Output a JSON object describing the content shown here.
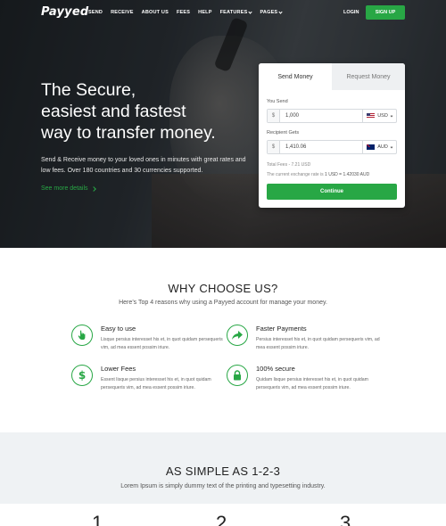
{
  "brand": {
    "logo": "Payyed",
    "accent": "#28a745"
  },
  "nav": {
    "items": [
      "SEND",
      "RECEIVE",
      "ABOUT US",
      "FEES",
      "HELP"
    ],
    "features_label": "FEATURES",
    "pages_label": "PAGES",
    "login_label": "LOGIN",
    "signup_label": "SIGN UP"
  },
  "hero": {
    "title_line1": "The Secure,",
    "title_line2": "easiest and fastest",
    "title_line3": "way to transfer money.",
    "text": "Send & Receive money to your loved ones in minutes with great rates and low fees. Over 180 countries and 30 currencies supported.",
    "see_more": "See more details"
  },
  "form": {
    "tab_send": "Send Money",
    "tab_request": "Request Money",
    "you_send_label": "You Send",
    "you_send_symbol": "$",
    "you_send_value": "1,000",
    "you_send_currency": "USD",
    "recipient_label": "Recipient Gets",
    "recipient_symbol": "$",
    "recipient_value": "1,410.06",
    "recipient_currency": "AUD",
    "fees_text": "Total Fees - 7.21 USD",
    "rate_prefix": "The current exchange rate is",
    "rate_value": "1 USD = 1.42030 AUD",
    "continue_label": "Continue"
  },
  "why": {
    "title": "WHY CHOOSE US?",
    "subtitle": "Here’s Top 4 reasons why using a Payyed account for manage your money.",
    "features": [
      {
        "title": "Easy to use",
        "text": "Lisque persius interesset his et, in quot quidam persequeris vim, ad mea essent possim iriure.",
        "icon": "hand-pointer-icon"
      },
      {
        "title": "Faster Payments",
        "text": "Persius interesset his et, in quot quidam persequeris vim, ad mea essent possim iriure.",
        "icon": "share-arrow-icon"
      },
      {
        "title": "Lower Fees",
        "text": "Essent lisque persius interesset his et, in quot quidam persequeris vim, ad mea essent possim iriure.",
        "icon": "dollar-icon"
      },
      {
        "title": "100% secure",
        "text": "Quidam lisque persius interesset his et, in quot quidam persequeris vim, ad mea essent possim iriure.",
        "icon": "lock-icon"
      }
    ]
  },
  "simple": {
    "title": "AS SIMPLE AS 1-2-3",
    "subtitle": "Lorem Ipsum is simply dummy text of the printing and typesetting industry.",
    "steps": [
      "1",
      "2",
      "3"
    ]
  }
}
